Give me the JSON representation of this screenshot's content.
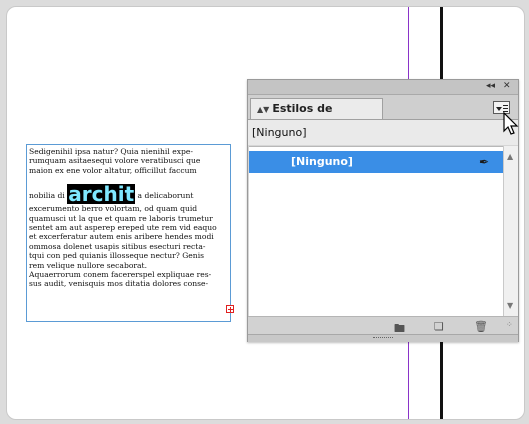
{
  "document": {
    "text_lines": [
      "Sedigenihil ipsa natur? Quia nienihil expe-",
      "rumquam asitaesequi volore veratibusci que",
      "maion ex ene volor altatur, officillut faccum"
    ],
    "big_word_prefix": "nobilia di ",
    "big_word": "archit",
    "big_word_suffix": " a delicaborunt",
    "body_lines": [
      "excerumento berro volortam, od quam quid",
      "quamusci ut la que et quam re laboris trumetur",
      "sentet am aut asperep ereped ute rem vid eaquo",
      "et excerferatur autem enis aribere hendes modi",
      "ommosa dolenet usapis sitibus esecturi recta-",
      "tqui con ped quianis illosseque nectur? Genis",
      "rem velique nullore secaborat.",
      "Aquaerrorum conem facererspel expliquae res-",
      "sus audit, venisquis mos ditatia dolores conse-"
    ]
  },
  "panel": {
    "collapse_icon": "double-left-arrow-icon",
    "close_icon": "close-icon",
    "tab_label": "Estilos de carácter",
    "current_style": "[Ninguno]",
    "styles": [
      {
        "name": "[Ninguno]",
        "selected": true
      }
    ],
    "bottom_icons": [
      "folder-icon",
      "new-style-icon",
      "trash-icon"
    ]
  },
  "colors": {
    "selection": "#3a8ee6",
    "guide_purple": "#8a33c9",
    "frame_border": "#5b9bd5",
    "highlight_text": "#7fe8ff",
    "overset": "#e02020"
  }
}
